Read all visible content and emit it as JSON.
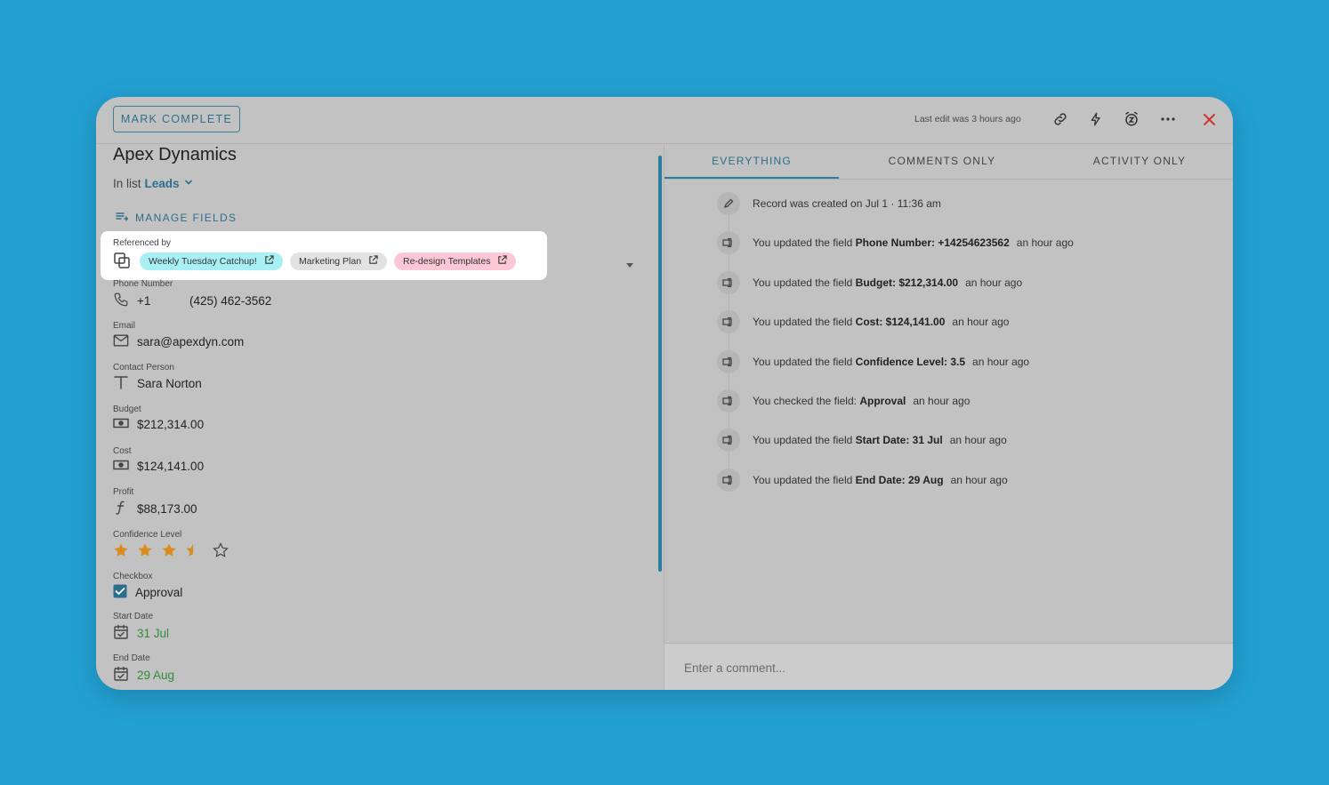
{
  "toolbar": {
    "mark_complete": "MARK COMPLETE",
    "last_edit": "Last edit was 3 hours ago",
    "icons": [
      "link-icon",
      "lightning-icon",
      "snooze-icon",
      "more-icon",
      "close-icon"
    ]
  },
  "record": {
    "title": "Apex Dynamics",
    "in_list_prefix": "In list",
    "list_name": "Leads",
    "manage_fields": "MANAGE FIELDS"
  },
  "references": {
    "label": "Referenced by",
    "chips": [
      {
        "label": "Weekly Tuesday Catchup!",
        "color": "#a9f0f4"
      },
      {
        "label": "Marketing Plan",
        "color": "#e2e2e2"
      },
      {
        "label": "Re-design Templates",
        "color": "#fcc7d7"
      }
    ]
  },
  "fields": {
    "phone": {
      "label": "Phone Number",
      "country": "+1",
      "value": "(425) 462-3562"
    },
    "email": {
      "label": "Email",
      "value": "sara@apexdyn.com"
    },
    "contact": {
      "label": "Contact Person",
      "value": "Sara Norton"
    },
    "budget": {
      "label": "Budget",
      "value": "$212,314.00"
    },
    "cost": {
      "label": "Cost",
      "value": "$124,141.00"
    },
    "profit": {
      "label": "Profit",
      "value": "$88,173.00"
    },
    "confidence": {
      "label": "Confidence Level",
      "rating": 3.5,
      "max": 5
    },
    "checkbox": {
      "label": "Checkbox",
      "value": "Approval",
      "checked": true
    },
    "start_date": {
      "label": "Start Date",
      "value": "31 Jul"
    },
    "end_date": {
      "label": "End Date",
      "value": "29 Aug"
    }
  },
  "tabs": [
    {
      "label": "EVERYTHING",
      "active": true
    },
    {
      "label": "COMMENTS ONLY",
      "active": false
    },
    {
      "label": "ACTIVITY ONLY",
      "active": false
    }
  ],
  "activity": [
    {
      "icon": "pencil-icon",
      "text": "Record was created on Jul 1 · 11:36 am",
      "field": "",
      "ago": ""
    },
    {
      "icon": "field-icon",
      "text": "You updated the field",
      "field": "Phone Number: +14254623562",
      "ago": "an hour ago"
    },
    {
      "icon": "field-icon",
      "text": "You updated the field",
      "field": "Budget: $212,314.00",
      "ago": "an hour ago"
    },
    {
      "icon": "field-icon",
      "text": "You updated the field",
      "field": "Cost: $124,141.00",
      "ago": "an hour ago"
    },
    {
      "icon": "field-icon",
      "text": "You updated the field",
      "field": "Confidence Level: 3.5",
      "ago": "an hour ago"
    },
    {
      "icon": "field-icon",
      "text": "You checked the field:",
      "field": "Approval",
      "ago": "an hour ago"
    },
    {
      "icon": "field-icon",
      "text": "You updated the field",
      "field": "Start Date: 31 Jul",
      "ago": "an hour ago"
    },
    {
      "icon": "field-icon",
      "text": "You updated the field",
      "field": "End Date: 29 Aug",
      "ago": "an hour ago"
    }
  ],
  "comment": {
    "placeholder": "Enter a comment..."
  },
  "colors": {
    "accent": "#2a7ea1",
    "background": "#23a0d2",
    "close": "#d32f2f",
    "date": "#2e8b3d",
    "star": "#d98b1e"
  }
}
